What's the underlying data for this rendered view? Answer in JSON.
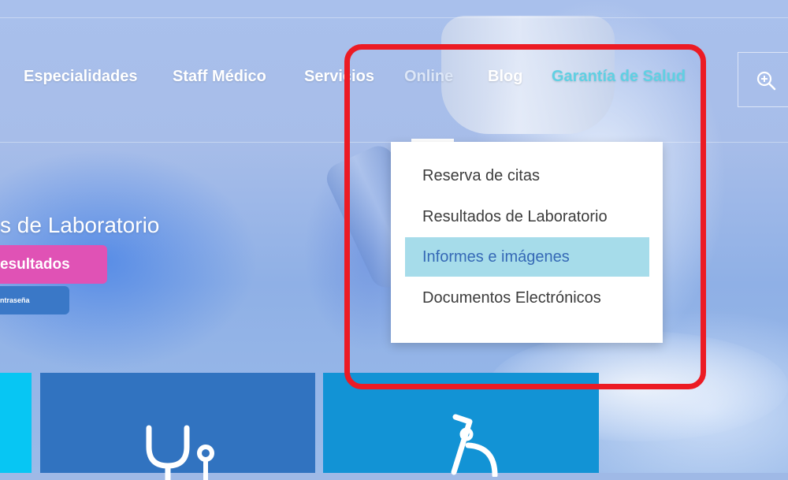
{
  "nav": {
    "items": [
      {
        "label": "Especialidades"
      },
      {
        "label": "Staff Médico"
      },
      {
        "label": "Servicios"
      },
      {
        "label": "Online"
      },
      {
        "label": "Blog"
      },
      {
        "label": "Garantía de Salud"
      }
    ]
  },
  "dropdown": {
    "items": [
      {
        "label": "Reserva de citas"
      },
      {
        "label": "Resultados de Laboratorio"
      },
      {
        "label": "Informes e imágenes"
      },
      {
        "label": "Documentos Electrónicos"
      }
    ],
    "active_index": 2
  },
  "hero": {
    "title": "s de Laboratorio",
    "primary_button": "esultados",
    "secondary_button": "ntraseña"
  },
  "icons": {
    "search": "zoom-in-icon",
    "tile_1": "stethoscope-icon",
    "tile_2": "microscope-icon"
  },
  "colors": {
    "highlight": "#ec1b24",
    "dropdown_active_bg": "#a6dcea",
    "dropdown_active_text": "#3569b6",
    "accent_nav": "#5fd0e3",
    "pink_button": "#e052b5",
    "blue_button": "#3a78c7",
    "tile_cyan": "#07c6f3",
    "tile_blue": "#3173c0",
    "tile_sky": "#1293d5"
  }
}
